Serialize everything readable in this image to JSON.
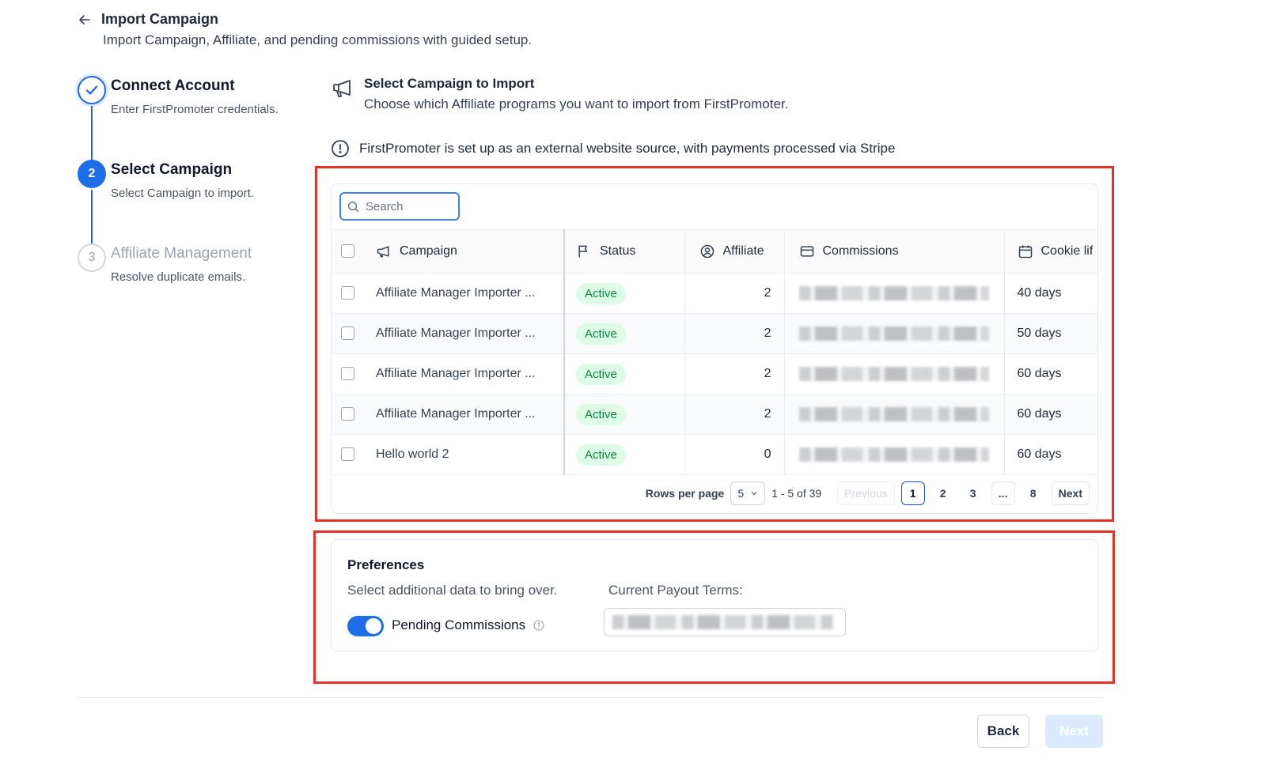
{
  "header": {
    "title": "Import Campaign",
    "subtitle": "Import Campaign, Affiliate, and pending commissions with guided setup."
  },
  "stepper": [
    {
      "number": "✓",
      "title": "Connect Account",
      "subtitle": "Enter FirstPromoter credentials.",
      "state": "done"
    },
    {
      "number": "2",
      "title": "Select Campaign",
      "subtitle": "Select Campaign to import.",
      "state": "active"
    },
    {
      "number": "3",
      "title": "Affiliate Management",
      "subtitle": "Resolve duplicate emails.",
      "state": "pending"
    }
  ],
  "section": {
    "title": "Select Campaign to Import",
    "subtitle": "Choose which Affiliate programs you want to import from FirstPromoter.",
    "icon": "megaphone-icon"
  },
  "notice": {
    "text": "FirstPromoter is set up as an external website source, with payments processed via Stripe",
    "icon": "alert-circle-icon"
  },
  "table": {
    "search_placeholder": "Search",
    "columns": {
      "campaign": "Campaign",
      "status": "Status",
      "affiliate": "Affiliate",
      "commissions": "Commissions",
      "cookie": "Cookie lif"
    },
    "rows": [
      {
        "campaign": "Affiliate Manager Importer ...",
        "status": "Active",
        "affiliate": "2",
        "cookie": "40 days"
      },
      {
        "campaign": "Affiliate Manager Importer ...",
        "status": "Active",
        "affiliate": "2",
        "cookie": "50 days"
      },
      {
        "campaign": "Affiliate Manager Importer ...",
        "status": "Active",
        "affiliate": "2",
        "cookie": "60 days"
      },
      {
        "campaign": "Affiliate Manager Importer ...",
        "status": "Active",
        "affiliate": "2",
        "cookie": "60 days"
      },
      {
        "campaign": "Hello world 2",
        "status": "Active",
        "affiliate": "0",
        "cookie": "60 days"
      }
    ],
    "pagination": {
      "rows_per_page_label": "Rows per page",
      "rows_per_page": "5",
      "range": "1 - 5 of 39",
      "previous": "Previous",
      "pages": [
        "1",
        "2",
        "3",
        "...",
        "8"
      ],
      "next": "Next"
    }
  },
  "preferences": {
    "title": "Preferences",
    "subtitle": "Select additional data to bring over.",
    "payout_label": "Current Payout Terms:",
    "toggle_label": "Pending Commissions",
    "toggle_on": true
  },
  "footer": {
    "back": "Back",
    "next": "Next"
  },
  "colors": {
    "accent": "#1d6ee8",
    "highlight": "#e53228",
    "status_active_bg": "#dcfce7",
    "status_active_fg": "#15803d"
  }
}
